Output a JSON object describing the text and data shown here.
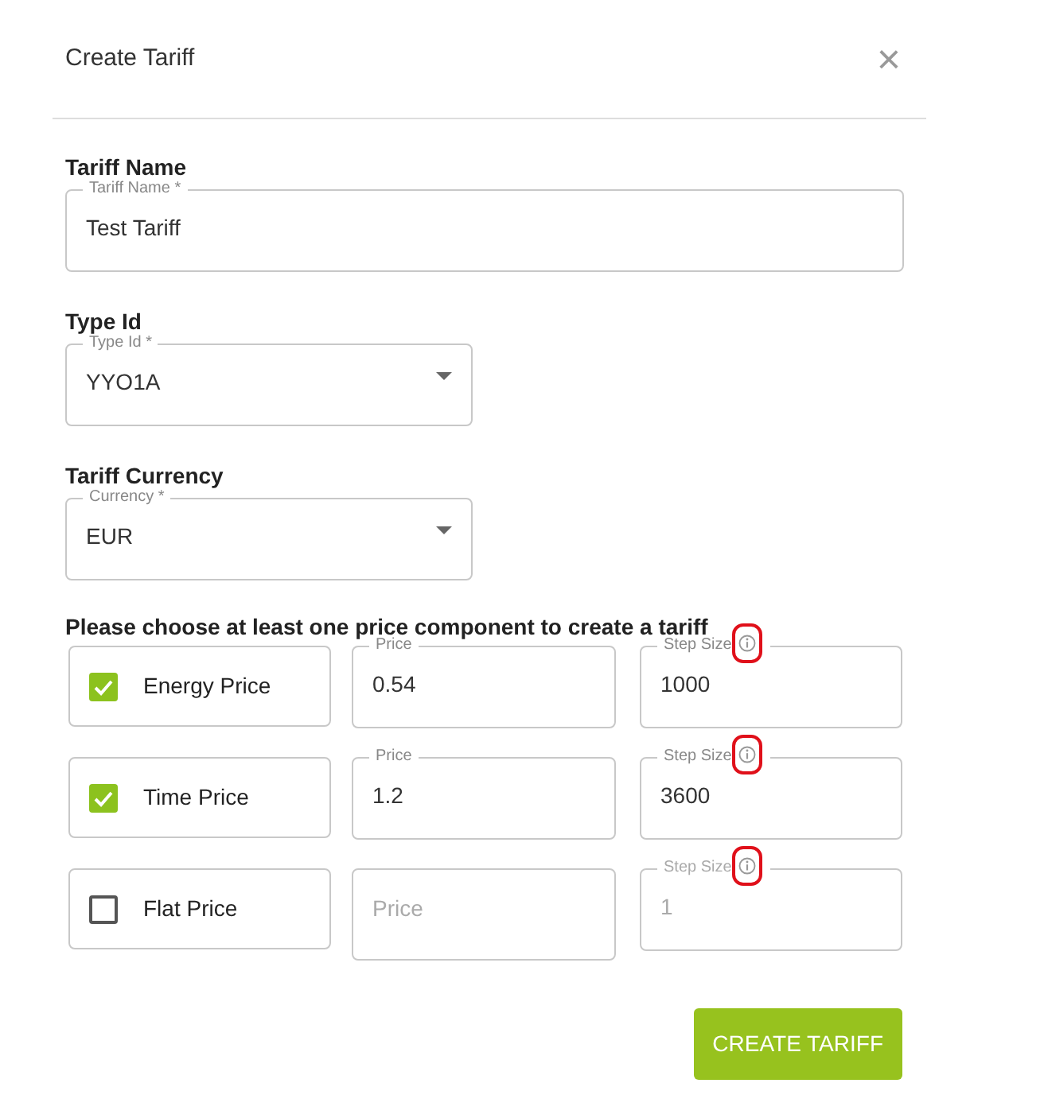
{
  "dialog": {
    "title": "Create Tariff",
    "close": "×"
  },
  "sections": [
    {
      "kind": "text",
      "heading": "Tariff Name",
      "label": "Tariff Name *",
      "value": "Test Tariff"
    },
    {
      "kind": "select",
      "heading": "Type Id",
      "label": "Type Id *",
      "value": "YYO1A"
    },
    {
      "kind": "select",
      "heading": "Tariff Currency",
      "label": "Currency *",
      "value": "EUR"
    }
  ],
  "components_heading": "Please choose at least one price component to create a tariff",
  "components": [
    {
      "label": "Energy Price",
      "checked": true,
      "price": {
        "label": "Price",
        "value": "0.54"
      },
      "step_size": {
        "label": "Step Size",
        "value": "1000",
        "disabled": false,
        "highlighted": true
      }
    },
    {
      "label": "Time Price",
      "checked": true,
      "price": {
        "label": "Price",
        "value": "1.2"
      },
      "step_size": {
        "label": "Step Size",
        "value": "3600",
        "disabled": false,
        "highlighted": true
      }
    },
    {
      "label": "Flat Price",
      "checked": false,
      "price": {
        "placeholder": "Price"
      },
      "step_size": {
        "label": "Step Size",
        "value": "1",
        "disabled": true,
        "highlighted": true
      }
    }
  ],
  "submit": "CREATE TARIFF"
}
